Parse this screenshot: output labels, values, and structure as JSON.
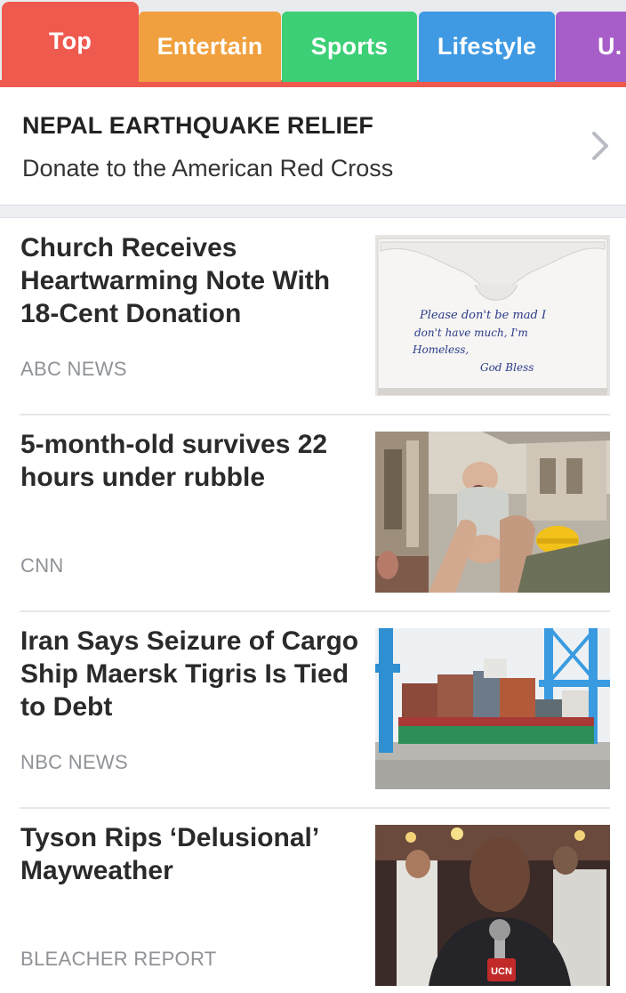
{
  "tabs": [
    {
      "label": "Top",
      "color": "#ef5a4f",
      "active": true
    },
    {
      "label": "Entertain",
      "color": "#f0a03e",
      "active": false
    },
    {
      "label": "Sports",
      "color": "#3ccf76",
      "active": false
    },
    {
      "label": "Lifestyle",
      "color": "#3f9ae3",
      "active": false
    },
    {
      "label": "U.",
      "color": "#a75ec9",
      "active": false
    }
  ],
  "banner": {
    "title": "NEPAL EARTHQUAKE RELIEF",
    "subtitle": "Donate to the American Red Cross",
    "icon": "chevron-right-icon"
  },
  "articles": [
    {
      "headline": "Church Receives Heartwarming Note With 18-Cent Donation",
      "source": "ABC NEWS",
      "note": {
        "line1": "Please don't be mad I",
        "line2": "don't have much, I'm",
        "line3": "Homeless,",
        "line4": "God Bless"
      }
    },
    {
      "headline": "5-month-old survives 22 hours under rubble",
      "source": "CNN"
    },
    {
      "headline": "Iran Says Seizure of Cargo Ship Maersk Tigris Is Tied to Debt",
      "source": "NBC NEWS"
    },
    {
      "headline": "Tyson Rips ‘Delusional’ Mayweather",
      "source": "BLEACHER REPORT",
      "mic_flag": "UCN"
    }
  ]
}
